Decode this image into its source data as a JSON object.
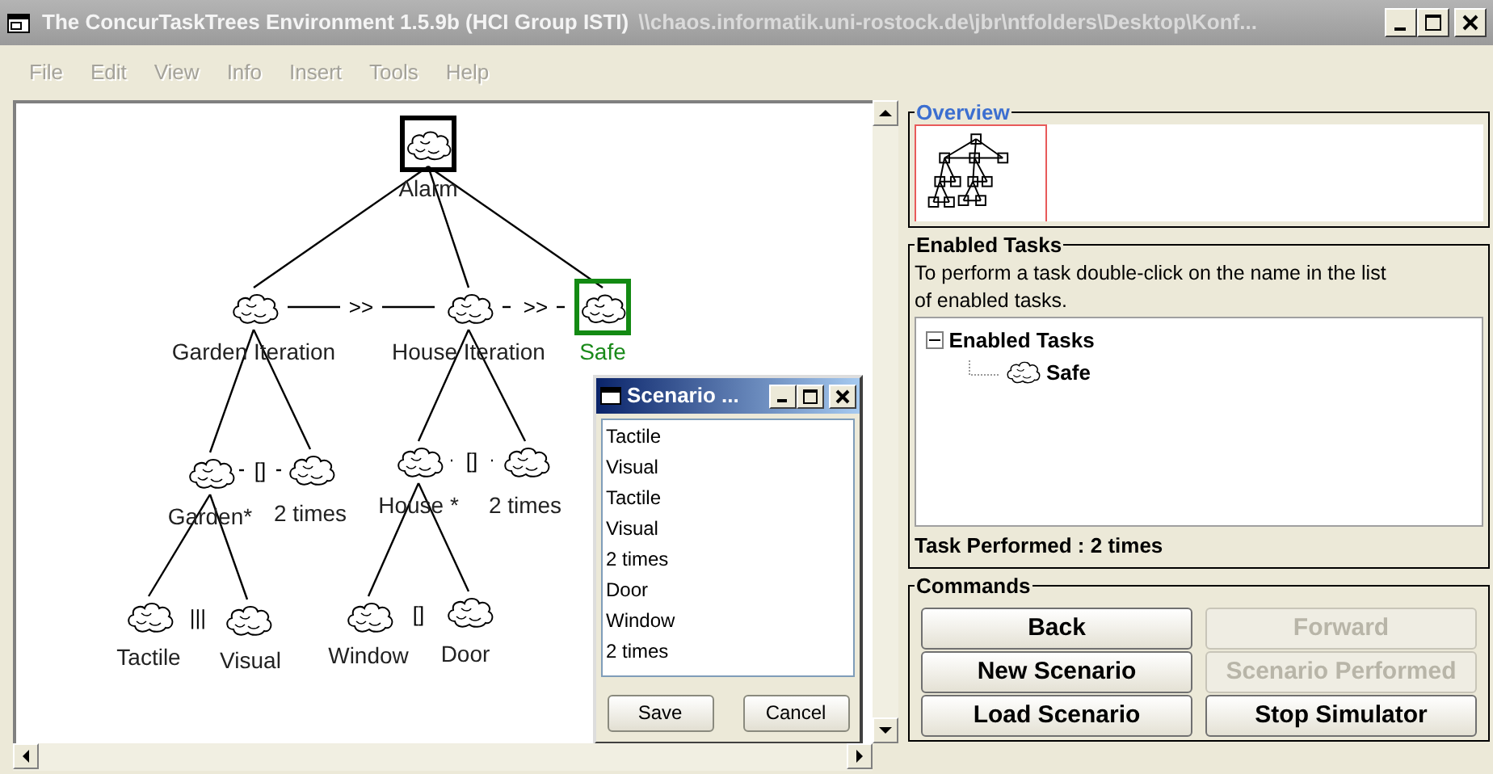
{
  "window": {
    "title": "The ConcurTaskTrees Environment 1.5.9b (HCI Group ISTI)",
    "path": "\\\\chaos.informatik.uni-rostock.de\\jbr\\ntfolders\\Desktop\\Konf..."
  },
  "menu": [
    {
      "label": "File",
      "disabled": true
    },
    {
      "label": "Edit",
      "disabled": true
    },
    {
      "label": "View",
      "disabled": true
    },
    {
      "label": "Info",
      "disabled": true
    },
    {
      "label": "Insert",
      "disabled": true
    },
    {
      "label": "Tools",
      "disabled": true
    },
    {
      "label": "Help",
      "disabled": true
    }
  ],
  "task_tree": {
    "name": "Alarm",
    "selected": true,
    "enabled": false,
    "children": [
      {
        "name": "Garden Iteration",
        "selected": false,
        "enabled": false,
        "operator": {
          "symbol": ">>",
          "kind": "solid"
        },
        "children": [
          {
            "name": "Garden*",
            "selected": false,
            "enabled": false,
            "operator": {
              "symbol": "[]",
              "kind": "dashed"
            },
            "children": [
              {
                "name": "Tactile",
                "selected": false,
                "enabled": false,
                "operator": {
                  "symbol": "|||",
                  "kind": "bare"
                }
              },
              {
                "name": "Visual",
                "selected": false,
                "enabled": false
              }
            ]
          },
          {
            "name": "2 times",
            "selected": false,
            "enabled": false
          }
        ]
      },
      {
        "name": "House Iteration",
        "selected": false,
        "enabled": false,
        "operator": {
          "symbol": ">>",
          "kind": "dashed"
        },
        "children": [
          {
            "name": "House *",
            "selected": false,
            "enabled": false,
            "operator": {
              "symbol": "[]",
              "kind": "dashed"
            },
            "children": [
              {
                "name": "Window",
                "selected": false,
                "enabled": false,
                "operator": {
                  "symbol": "[]",
                  "kind": "bare"
                }
              },
              {
                "name": "Door",
                "selected": false,
                "enabled": false
              }
            ]
          },
          {
            "name": "2 times",
            "selected": false,
            "enabled": false
          }
        ]
      },
      {
        "name": "Safe",
        "selected": false,
        "enabled": true
      }
    ]
  },
  "scenario_dialog": {
    "title": "Scenario ...",
    "items": [
      "Tactile",
      "Visual",
      "Tactile",
      "Visual",
      "2 times",
      "Door",
      "Window",
      "2 times"
    ],
    "buttons": [
      "Save",
      "Cancel"
    ]
  },
  "overview": {
    "legend": "Overview"
  },
  "enabled_tasks": {
    "legend": "Enabled Tasks",
    "hint": "To perform a task double-click on the name in the list of enabled tasks.",
    "tree": {
      "label": "Enabled Tasks",
      "expanded": true,
      "children": [
        {
          "label": "Safe"
        }
      ]
    },
    "status": "Task Performed : 2 times"
  },
  "commands": {
    "legend": "Commands",
    "buttons": [
      {
        "label": "Back",
        "disabled": false
      },
      {
        "label": "Forward",
        "disabled": true
      },
      {
        "label": "New Scenario",
        "disabled": false
      },
      {
        "label": "Scenario Performed",
        "disabled": true
      },
      {
        "label": "Load Scenario",
        "disabled": false
      },
      {
        "label": "Stop Simulator",
        "disabled": false
      }
    ]
  }
}
